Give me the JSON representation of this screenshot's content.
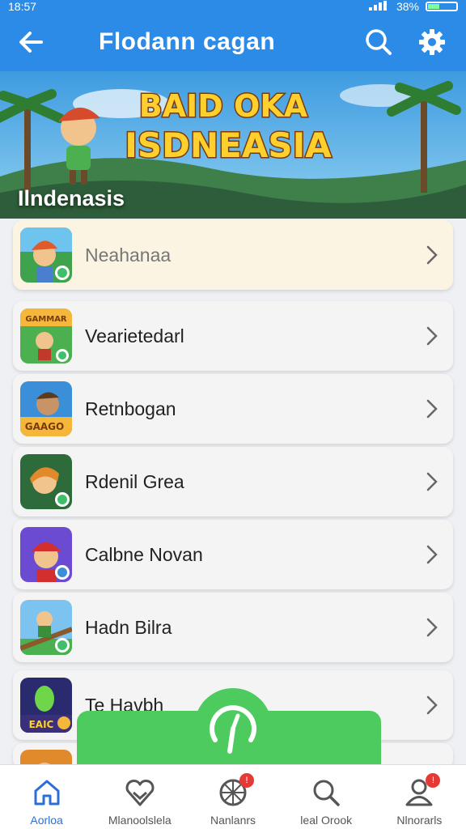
{
  "status_bar": {
    "time": "18:57",
    "battery": "38%",
    "battery_level": 0.38
  },
  "app_bar": {
    "title": "Flodann cagan",
    "back_icon": "arrow-left-icon",
    "search_icon": "search-icon",
    "settings_icon": "gear-icon"
  },
  "banner": {
    "logo_line1": "BAID OKA",
    "logo_line2": "ISDNEASIA",
    "title": "Ilndenasis"
  },
  "games": [
    {
      "label": "Neahanaa",
      "icon": "game-thumbnail",
      "highlighted": true
    },
    {
      "label": "Vearietedarl",
      "icon": "game-thumbnail",
      "thumb_text": "GAMMAR"
    },
    {
      "label": "Retnbogan",
      "icon": "game-thumbnail",
      "thumb_text": "GAAGO"
    },
    {
      "label": "Rdenil Grea",
      "icon": "game-thumbnail"
    },
    {
      "label": "Calbne Novan",
      "icon": "game-thumbnail"
    },
    {
      "label": "Hadn Bilra",
      "icon": "game-thumbnail"
    },
    {
      "label": "Te Havbh",
      "icon": "game-thumbnail",
      "thumb_text": "EAIC"
    }
  ],
  "fab": {
    "icon": "gauge-icon"
  },
  "bottom_nav": [
    {
      "label": "Aorloa",
      "icon": "home-icon",
      "active": true
    },
    {
      "label": "Mlanoolslela",
      "icon": "heart-shield-icon"
    },
    {
      "label": "Nanlanrs",
      "icon": "ball-icon",
      "badge": "!"
    },
    {
      "label": "leal Orook",
      "icon": "search-icon"
    },
    {
      "label": "Nlnorarls",
      "icon": "profile-icon",
      "badge": "!"
    }
  ],
  "colors": {
    "primary": "#2b8be6",
    "fab_green": "#4ecb5e",
    "badge_red": "#e53935",
    "active_nav": "#2b6fd6"
  }
}
